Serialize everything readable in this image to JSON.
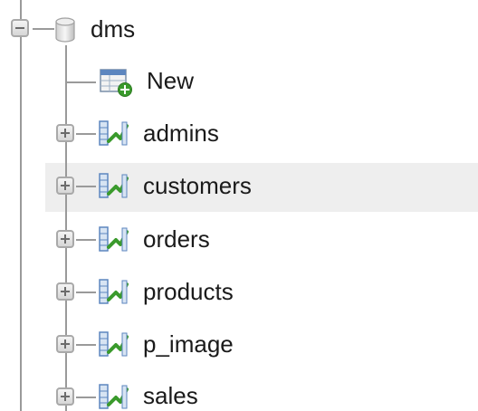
{
  "tree": {
    "database": {
      "name": "dms",
      "icon": "database-icon"
    },
    "new_item": {
      "label": "New",
      "icon": "new-table-icon"
    },
    "tables": [
      {
        "name": "admins",
        "icon": "table-icon",
        "expander": "expand-plus-icon"
      },
      {
        "name": "customers",
        "icon": "table-icon",
        "expander": "expand-plus-icon"
      },
      {
        "name": "orders",
        "icon": "table-icon",
        "expander": "expand-plus-icon"
      },
      {
        "name": "products",
        "icon": "table-icon",
        "expander": "expand-plus-icon"
      },
      {
        "name": "p_image",
        "icon": "table-icon",
        "expander": "expand-plus-icon"
      },
      {
        "name": "sales",
        "icon": "table-icon",
        "expander": "expand-plus-icon"
      }
    ],
    "highlighted_row": "customers"
  },
  "colors": {
    "connector": "#9a9a9a",
    "highlight": "#eeeeee",
    "icon_green": "#3a9a2c",
    "icon_blue": "#3d6fb6"
  }
}
